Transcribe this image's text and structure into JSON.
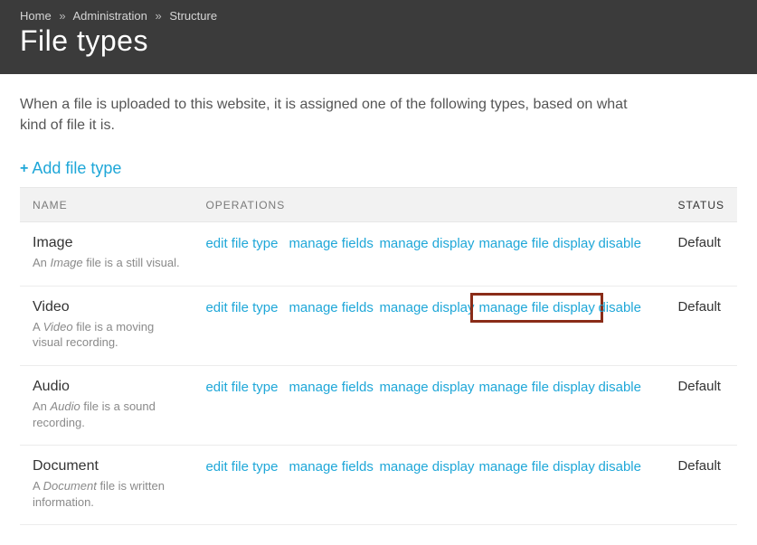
{
  "breadcrumb": {
    "items": [
      "Home",
      "Administration",
      "Structure"
    ],
    "separator": "»"
  },
  "page_title": "File types",
  "intro": "When a file is uploaded to this website, it is assigned one of the following types, based on what kind of file it is.",
  "add_link": {
    "label": "Add file type",
    "icon": "+"
  },
  "table": {
    "headers": {
      "name": "NAME",
      "operations": "OPERATIONS",
      "status": "STATUS"
    },
    "op_labels": {
      "edit": "edit file type",
      "fields": "manage fields",
      "display": "manage display",
      "file_display": "manage file display",
      "disable": "disable"
    },
    "rows": [
      {
        "name": "Image",
        "desc_pre": "An ",
        "desc_em": "Image",
        "desc_post": " file is a still visual.",
        "status": "Default",
        "highlight_file_display": false
      },
      {
        "name": "Video",
        "desc_pre": "A ",
        "desc_em": "Video",
        "desc_post": " file is a moving visual recording.",
        "status": "Default",
        "highlight_file_display": true
      },
      {
        "name": "Audio",
        "desc_pre": "An ",
        "desc_em": "Audio",
        "desc_post": " file is a sound recording.",
        "status": "Default",
        "highlight_file_display": false
      },
      {
        "name": "Document",
        "desc_pre": "A ",
        "desc_em": "Document",
        "desc_post": " file is written information.",
        "status": "Default",
        "highlight_file_display": false
      }
    ]
  }
}
